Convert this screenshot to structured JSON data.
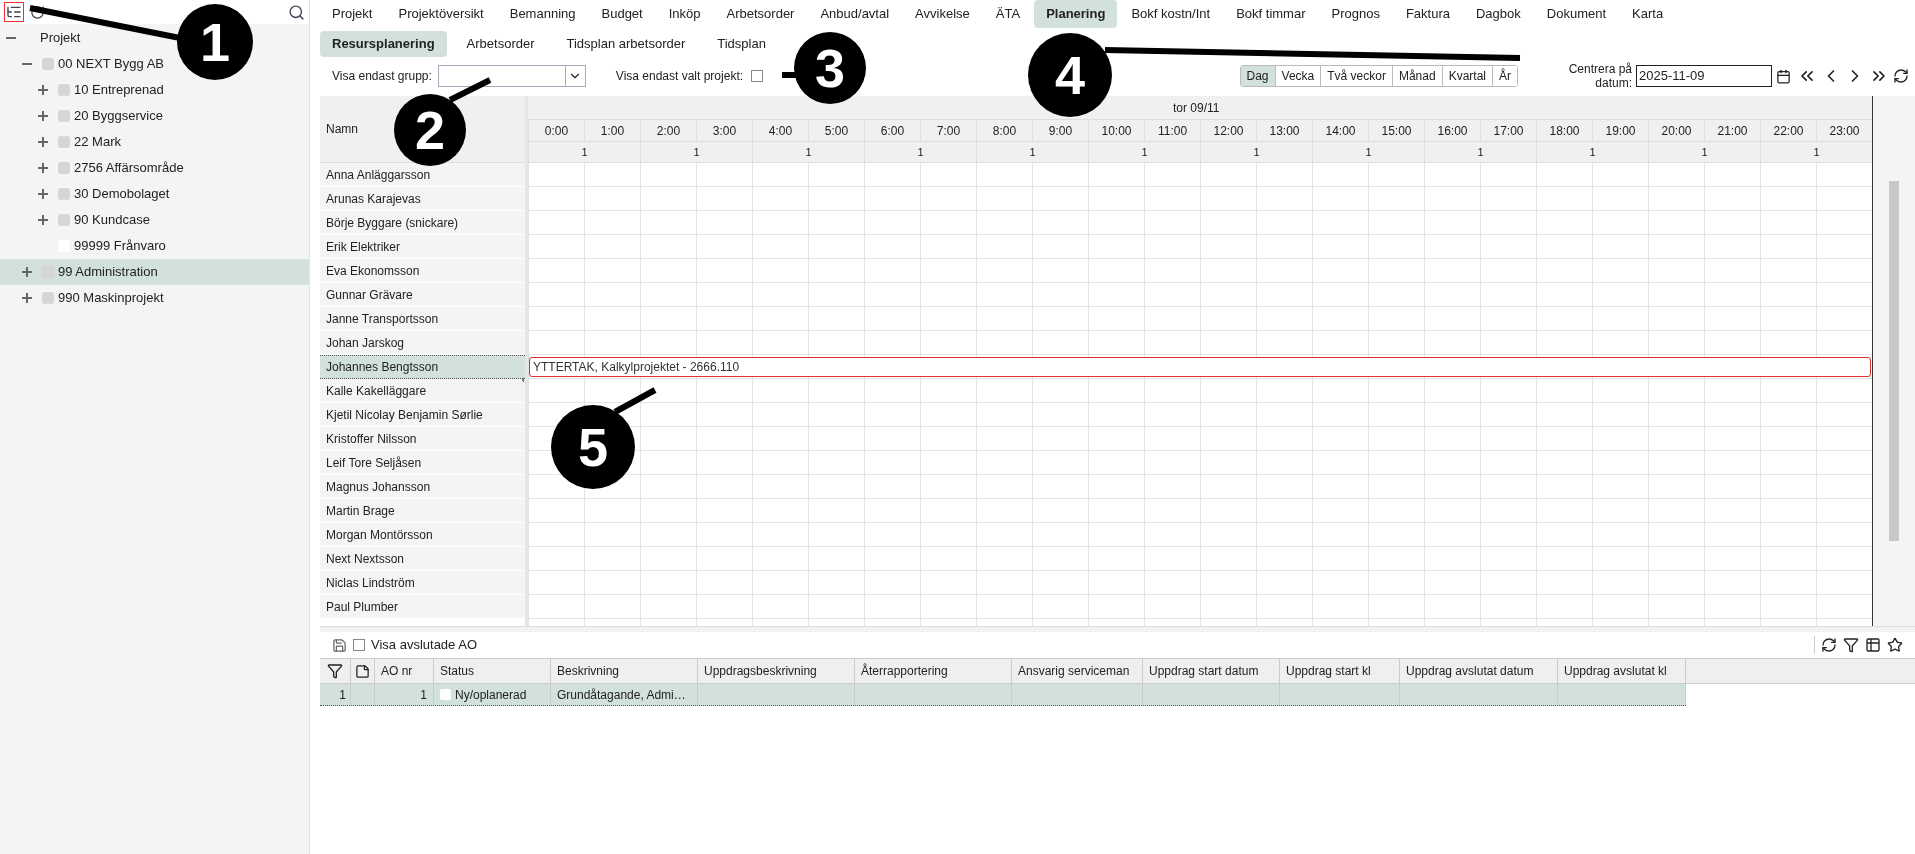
{
  "tree": [
    {
      "label": "Projekt",
      "kind": "root",
      "expanded": true,
      "selected": false,
      "children": [
        {
          "label": "00 NEXT Bygg AB",
          "kind": "folder",
          "expanded": true,
          "selected": false,
          "children": [
            {
              "label": "10 Entreprenad",
              "kind": "folder",
              "expanded": false,
              "selected": false
            },
            {
              "label": "20 Byggservice",
              "kind": "folder",
              "expanded": false,
              "selected": false
            },
            {
              "label": "22 Mark",
              "kind": "folder",
              "expanded": false,
              "selected": false
            },
            {
              "label": "2756 Affärsområde",
              "kind": "folder",
              "expanded": false,
              "selected": false
            },
            {
              "label": "30 Demobolaget",
              "kind": "folder",
              "expanded": false,
              "selected": false
            },
            {
              "label": "90 Kundcase",
              "kind": "folder",
              "expanded": false,
              "selected": false
            },
            {
              "label": "99999 Frånvaro",
              "kind": "leaf",
              "selected": false
            }
          ]
        },
        {
          "label": "99 Administration",
          "kind": "folder",
          "expanded": false,
          "selected": true
        },
        {
          "label": "990 Maskinprojekt",
          "kind": "folder",
          "expanded": false,
          "selected": false
        }
      ]
    }
  ],
  "tabs": [
    {
      "label": "Projekt",
      "selected": false
    },
    {
      "label": "Projektöversikt",
      "selected": false
    },
    {
      "label": "Bemanning",
      "selected": false
    },
    {
      "label": "Budget",
      "selected": false
    },
    {
      "label": "Inköp",
      "selected": false
    },
    {
      "label": "Arbetsorder",
      "selected": false
    },
    {
      "label": "Anbud/avtal",
      "selected": false
    },
    {
      "label": "Avvikelse",
      "selected": false
    },
    {
      "label": "ÄTA",
      "selected": false
    },
    {
      "label": "Planering",
      "selected": true
    },
    {
      "label": "Bokf kostn/Int",
      "selected": false
    },
    {
      "label": "Bokf timmar",
      "selected": false
    },
    {
      "label": "Prognos",
      "selected": false
    },
    {
      "label": "Faktura",
      "selected": false
    },
    {
      "label": "Dagbok",
      "selected": false
    },
    {
      "label": "Dokument",
      "selected": false
    },
    {
      "label": "Karta",
      "selected": false
    }
  ],
  "subtabs": [
    {
      "label": "Resursplanering",
      "selected": true
    },
    {
      "label": "Arbetsorder",
      "selected": false
    },
    {
      "label": "Tidsplan arbetsorder",
      "selected": false
    },
    {
      "label": "Tidsplan",
      "selected": false
    }
  ],
  "group_filter": {
    "label": "Visa endast grupp:"
  },
  "project_filter": {
    "label": "Visa endast valt projekt:",
    "checked": false
  },
  "view_buttons": [
    {
      "label": "Dag",
      "selected": true
    },
    {
      "label": "Vecka",
      "selected": false
    },
    {
      "label": "Två veckor",
      "selected": false
    },
    {
      "label": "Månad",
      "selected": false
    },
    {
      "label": "Kvartal",
      "selected": false
    },
    {
      "label": "År",
      "selected": false
    }
  ],
  "date_field": {
    "label": "Centrera på datum:",
    "value": "2025-11-09"
  },
  "grid": {
    "name_header": "Namn",
    "day_label": "tor 09/11",
    "hours": [
      "0:00",
      "1:00",
      "2:00",
      "3:00",
      "4:00",
      "5:00",
      "6:00",
      "7:00",
      "8:00",
      "9:00",
      "10:00",
      "11:00",
      "12:00",
      "13:00",
      "14:00",
      "15:00",
      "16:00",
      "17:00",
      "18:00",
      "19:00",
      "20:00",
      "21:00",
      "22:00",
      "23:00"
    ],
    "counts": [
      "1",
      "1",
      "1",
      "1",
      "1",
      "1",
      "1",
      "1",
      "1",
      "1",
      "1",
      "1"
    ],
    "resources": [
      {
        "name": "Anna Anläggarsson",
        "selected": false
      },
      {
        "name": "Arunas Karajevas",
        "selected": false
      },
      {
        "name": "Börje Byggare (snickare)",
        "selected": false
      },
      {
        "name": "Erik Elektriker",
        "selected": false
      },
      {
        "name": "Eva Ekonomsson",
        "selected": false
      },
      {
        "name": "Gunnar Grävare",
        "selected": false
      },
      {
        "name": "Janne Transportsson",
        "selected": false
      },
      {
        "name": "Johan Jarskog",
        "selected": false
      },
      {
        "name": "Johannes Bengtsson",
        "selected": true,
        "booking": "YTTERTAK, Kalkylprojektet - 2666.110"
      },
      {
        "name": "Kalle Kakelläggare",
        "selected": false
      },
      {
        "name": "Kjetil Nicolay Benjamin Sørlie",
        "selected": false
      },
      {
        "name": "Kristoffer Nilsson",
        "selected": false
      },
      {
        "name": "Leif Tore Seljåsen",
        "selected": false
      },
      {
        "name": "Magnus Johansson",
        "selected": false
      },
      {
        "name": "Martin Brage",
        "selected": false
      },
      {
        "name": "Morgan Montörsson",
        "selected": false
      },
      {
        "name": "Next Nextsson",
        "selected": false
      },
      {
        "name": "Niclas Lindström",
        "selected": false
      },
      {
        "name": "Paul Plumber",
        "selected": false
      }
    ]
  },
  "work_orders": {
    "show_closed": {
      "label": "Visa avslutade AO",
      "checked": false
    },
    "columns": [
      "AO nr",
      "Status",
      "Beskrivning",
      "Uppdragsbeskrivning",
      "Återrapportering",
      "Ansvarig serviceman",
      "Uppdrag start datum",
      "Uppdrag start kl",
      "Uppdrag avslutat datum",
      "Uppdrag avslutat kl"
    ],
    "rows": [
      {
        "selected": true,
        "row_number": "1",
        "cells": [
          "1",
          "Ny/oplanerad",
          "Grundåtagande, Admi…"
        ]
      }
    ]
  },
  "callouts": [
    {
      "label": "1"
    },
    {
      "label": "2"
    },
    {
      "label": "3"
    },
    {
      "label": "4"
    },
    {
      "label": "5"
    }
  ]
}
